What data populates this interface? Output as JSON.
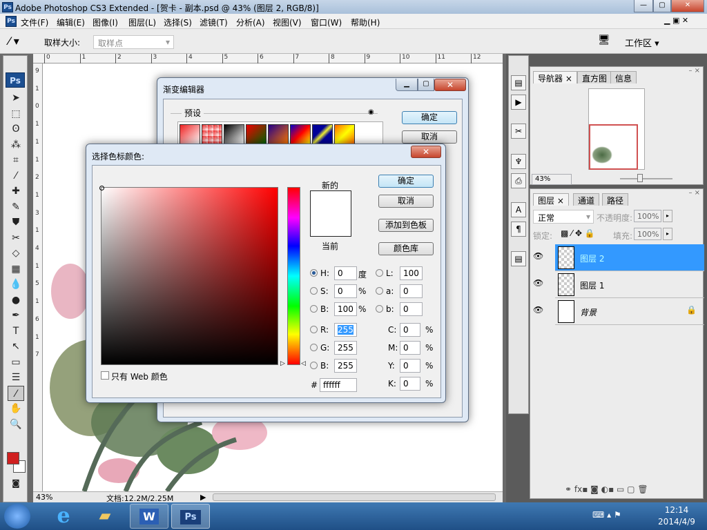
{
  "title": "Adobe Photoshop CS3 Extended - [贺卡 - 副本.psd @ 43% (图层 2, RGB/8)]",
  "app_icon": "Ps",
  "menu": [
    "文件(F)",
    "编辑(E)",
    "图像(I)",
    "图层(L)",
    "选择(S)",
    "滤镜(T)",
    "分析(A)",
    "视图(V)",
    "窗口(W)",
    "帮助(H)"
  ],
  "options": {
    "sample_size_label": "取样大小:",
    "sample_size_value": "取样点",
    "workspace": "工作区 ▾"
  },
  "ruler_top": [
    "0",
    "1",
    "2",
    "3",
    "4",
    "5",
    "6",
    "7",
    "8",
    "9",
    "10",
    "11",
    "12"
  ],
  "ruler_left": [
    "9",
    "1",
    "0",
    "1",
    "1",
    "1",
    "2",
    "1",
    "3",
    "1",
    "4",
    "1",
    "5",
    "1",
    "6",
    "1",
    "7"
  ],
  "status": {
    "zoom": "43%",
    "doc": "文档:12.2M/2.25M"
  },
  "navigator": {
    "tabs": [
      "导航器",
      "直方图",
      "信息"
    ],
    "zoom": "43%"
  },
  "layers": {
    "tabs": [
      "图层",
      "通道",
      "路径"
    ],
    "blend_mode": "正常",
    "opacity_label": "不透明度:",
    "opacity": "100%",
    "lock_label": "锁定:",
    "fill_label": "填充:",
    "fill": "100%",
    "items": [
      {
        "name": "图层 2",
        "selected": true
      },
      {
        "name": "图层 1",
        "selected": false
      },
      {
        "name": "背景",
        "selected": false,
        "locked": true
      }
    ]
  },
  "gradient_editor": {
    "title": "渐变编辑器",
    "presets_label": "预设",
    "ok": "确定",
    "cancel": "取消"
  },
  "color_picker": {
    "title": "选择色标颜色:",
    "new_label": "新的",
    "current_label": "当前",
    "ok": "确定",
    "cancel": "取消",
    "add_swatch": "添加到色板",
    "color_library": "颜色库",
    "web_only": "只有 Web 颜色",
    "hsb": [
      {
        "label": "H:",
        "value": "0",
        "unit": "度",
        "selected": true
      },
      {
        "label": "S:",
        "value": "0",
        "unit": "%"
      },
      {
        "label": "B:",
        "value": "100",
        "unit": "%"
      }
    ],
    "lab": [
      {
        "label": "L:",
        "value": "100"
      },
      {
        "label": "a:",
        "value": "0"
      },
      {
        "label": "b:",
        "value": "0"
      }
    ],
    "rgb": [
      {
        "label": "R:",
        "value": "255"
      },
      {
        "label": "G:",
        "value": "255"
      },
      {
        "label": "B:",
        "value": "255"
      }
    ],
    "cmyk": [
      {
        "label": "C:",
        "value": "0",
        "unit": "%"
      },
      {
        "label": "M:",
        "value": "0",
        "unit": "%"
      },
      {
        "label": "Y:",
        "value": "0",
        "unit": "%"
      },
      {
        "label": "K:",
        "value": "0",
        "unit": "%"
      }
    ],
    "hex_label": "#",
    "hex": "ffffff",
    "new_color": "#ffffff",
    "hue_color": "#ff0000"
  },
  "foreground_color": "#d02020",
  "taskbar": {
    "apps": [
      "e",
      "W",
      "Ps"
    ],
    "time": "12:14",
    "date": "2014/4/9"
  }
}
